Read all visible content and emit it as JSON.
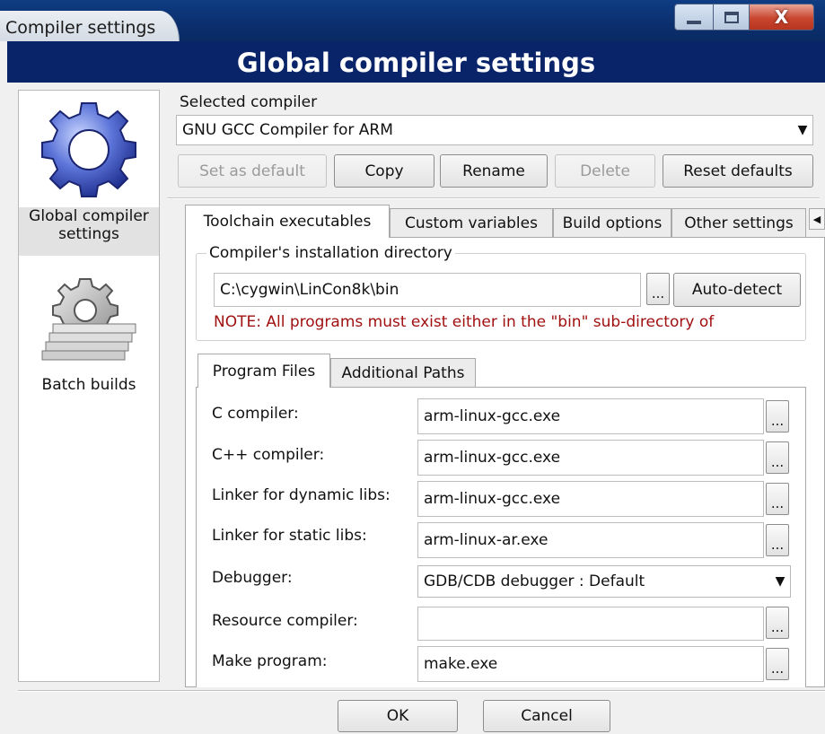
{
  "window": {
    "title": "Compiler settings",
    "min_glyph": "",
    "close_glyph": "X"
  },
  "header": {
    "title": "Global compiler settings"
  },
  "sidebar": {
    "items": [
      {
        "label_line1": "Global compiler",
        "label_line2": "settings",
        "icon": "gear-icon",
        "selected": true
      },
      {
        "label_line1": "Batch builds",
        "label_line2": "",
        "icon": "batch-gears-icon",
        "selected": false
      }
    ]
  },
  "compiler": {
    "selected_label": "Selected compiler",
    "selected_value": "GNU GCC Compiler for ARM",
    "buttons": {
      "set_default": "Set as default",
      "copy": "Copy",
      "rename": "Rename",
      "delete": "Delete",
      "reset": "Reset defaults"
    }
  },
  "tabs": {
    "toolchain": "Toolchain executables",
    "custom_vars": "Custom variables",
    "build_options": "Build options",
    "other_settings": "Other settings",
    "scroll_glyph": "◀"
  },
  "install_dir": {
    "group_title": "Compiler's installation directory",
    "value": "C:\\cygwin\\LinCon8k\\bin",
    "browse": "...",
    "auto_detect": "Auto-detect",
    "note": "NOTE: All programs must exist either in the \"bin\"  sub-directory of"
  },
  "inner_tabs": {
    "program_files": "Program Files",
    "additional_paths": "Additional Paths"
  },
  "program_files": {
    "c_compiler": {
      "label": "C compiler:",
      "value": "arm-linux-gcc.exe"
    },
    "cpp_compiler": {
      "label": "C++ compiler:",
      "value": "arm-linux-gcc.exe"
    },
    "linker_dynamic": {
      "label": "Linker for dynamic libs:",
      "value": "arm-linux-gcc.exe"
    },
    "linker_static": {
      "label": "Linker for static libs:",
      "value": "arm-linux-ar.exe"
    },
    "debugger": {
      "label": "Debugger:",
      "value": "GDB/CDB debugger : Default"
    },
    "resource_compiler": {
      "label": "Resource compiler:",
      "value": ""
    },
    "make_program": {
      "label": "Make program:",
      "value": "make.exe"
    },
    "browse": "..."
  },
  "footer": {
    "ok": "OK",
    "cancel": "Cancel"
  },
  "colors": {
    "header_bg": "#0a246a",
    "note_text": "#a01010",
    "titlebar": "#0b2f6e"
  }
}
